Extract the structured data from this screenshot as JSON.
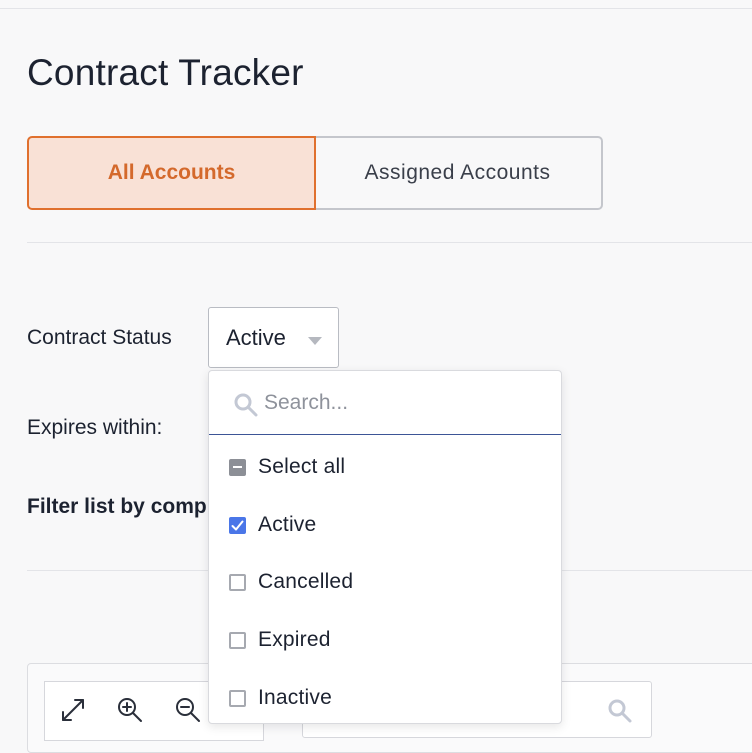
{
  "page": {
    "title": "Contract Tracker"
  },
  "tabs": [
    {
      "label": "All Accounts",
      "active": true
    },
    {
      "label": "Assigned Accounts",
      "active": false
    }
  ],
  "filters": {
    "contract_status_label": "Contract Status",
    "contract_status_value": "Active",
    "expires_within_label": "Expires within:",
    "filter_company_label": "Filter list by comp"
  },
  "dropdown": {
    "search_placeholder": "Search...",
    "select_all_label": "Select all",
    "select_all_state": "indeterminate",
    "options": [
      {
        "label": "Active",
        "checked": true
      },
      {
        "label": "Cancelled",
        "checked": false
      },
      {
        "label": "Expired",
        "checked": false
      },
      {
        "label": "Inactive",
        "checked": false
      }
    ]
  },
  "toolbar": {
    "icons": [
      "expand-icon",
      "zoom-in-icon",
      "zoom-out-icon"
    ]
  },
  "colors": {
    "accent": "#e0702e",
    "accent_bg": "#f9e1d6",
    "checkbox_checked": "#4a76e8",
    "search_underline": "#3d5596"
  }
}
